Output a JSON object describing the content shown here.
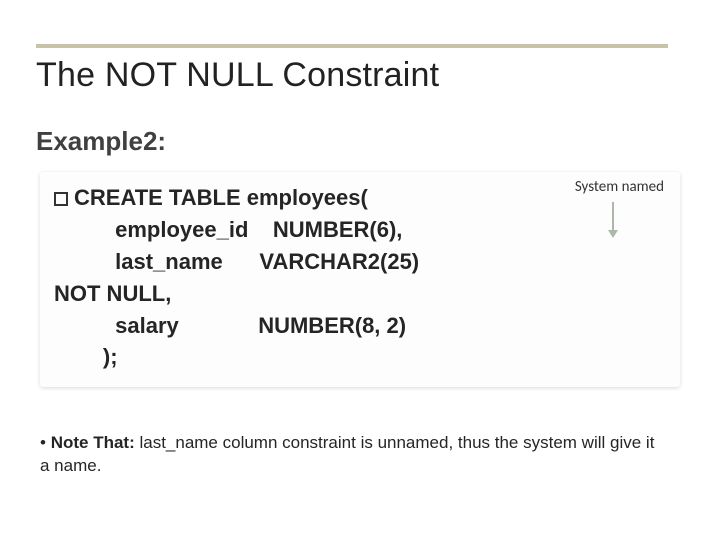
{
  "title": "The NOT NULL Constraint",
  "subtitle": "Example2:",
  "annotation": "System named",
  "code": {
    "l1a": "CREATE TABLE employees(",
    "l2": "          employee_id    NUMBER(6),",
    "l3": "          last_name      VARCHAR2(25) ",
    "l4": "NOT NULL",
    "l4b": ",",
    "l5": "          salary             NUMBER(8, 2)",
    "l6": "        );"
  },
  "note": {
    "prefix": "• ",
    "bold": "Note That:",
    "rest": " last_name column constraint is unnamed, thus the system will give it a name."
  }
}
